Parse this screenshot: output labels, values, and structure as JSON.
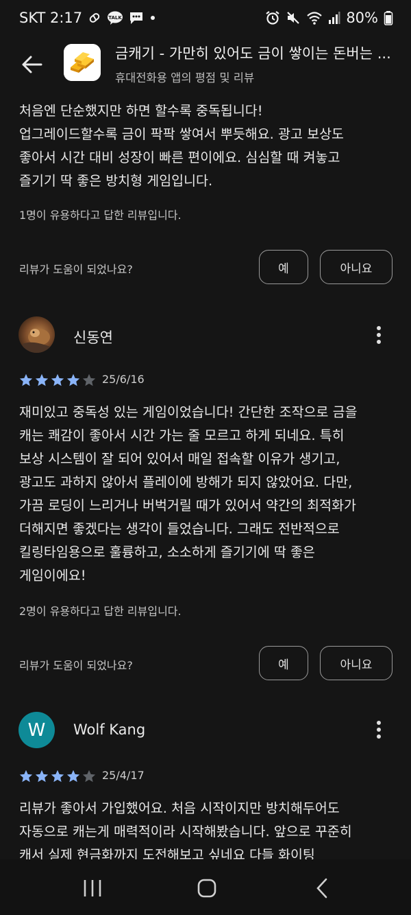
{
  "status": {
    "time": "SKT 2:17",
    "battery": "80%"
  },
  "header": {
    "title": "금캐기 - 가만히 있어도 금이 쌓이는 돈버는 ...",
    "subtitle": "휴대전화용 앱의 평점 및 리뷰"
  },
  "reviews": [
    {
      "body": "처음엔 단순했지만 하면 할수록 중독됩니다!\n업그레이드할수록 금이 팍팍 쌓여서 뿌듯해요. 광고 보상도\n좋아서 시간 대비 성장이 빠른 편이에요. 심심할 때 켜놓고\n즐기기 딱 좋은 방치형 게임입니다.",
      "helpful_count": "1명이 유용하다고 답한 리뷰입니다.",
      "helpful_question": "리뷰가 도움이 되었나요?",
      "yes_label": "예",
      "no_label": "아니요"
    },
    {
      "name": "신동연",
      "rating": 4,
      "date": "25/6/16",
      "body": "재미있고 중독성 있는 게임이었습니다! 간단한 조작으로 금을\n캐는 쾌감이 좋아서 시간 가는 줄 모르고 하게 되네요. 특히\n보상 시스템이 잘 되어 있어서 매일 접속할 이유가 생기고,\n광고도 과하지 않아서 플레이에 방해가 되지 않았어요. 다만,\n가끔 로딩이 느리거나 버벅거릴 때가 있어서 약간의 최적화가\n더해지면 좋겠다는 생각이 들었습니다. 그래도 전반적으로\n킬링타임용으로 훌륭하고, 소소하게 즐기기에 딱 좋은\n게임이에요!",
      "helpful_count": "2명이 유용하다고 답한 리뷰입니다.",
      "helpful_question": "리뷰가 도움이 되었나요?",
      "yes_label": "예",
      "no_label": "아니요"
    },
    {
      "name": "Wolf Kang",
      "avatar_letter": "W",
      "avatar_color": "#0e8a97",
      "rating": 4,
      "date": "25/4/17",
      "body": "리뷰가 좋아서 가입했어요. 처음 시작이지만 방치해두어도\n자동으로 캐는게 매력적이라 시작해봤습니다. 앞으로 꾸준히\n캐서 실제 현금화까지 도전해보고 싶네요 다들 화이팅"
    }
  ],
  "colors": {
    "star_filled": "#8ab4f8",
    "star_empty": "#5f6368",
    "background": "#151515"
  }
}
